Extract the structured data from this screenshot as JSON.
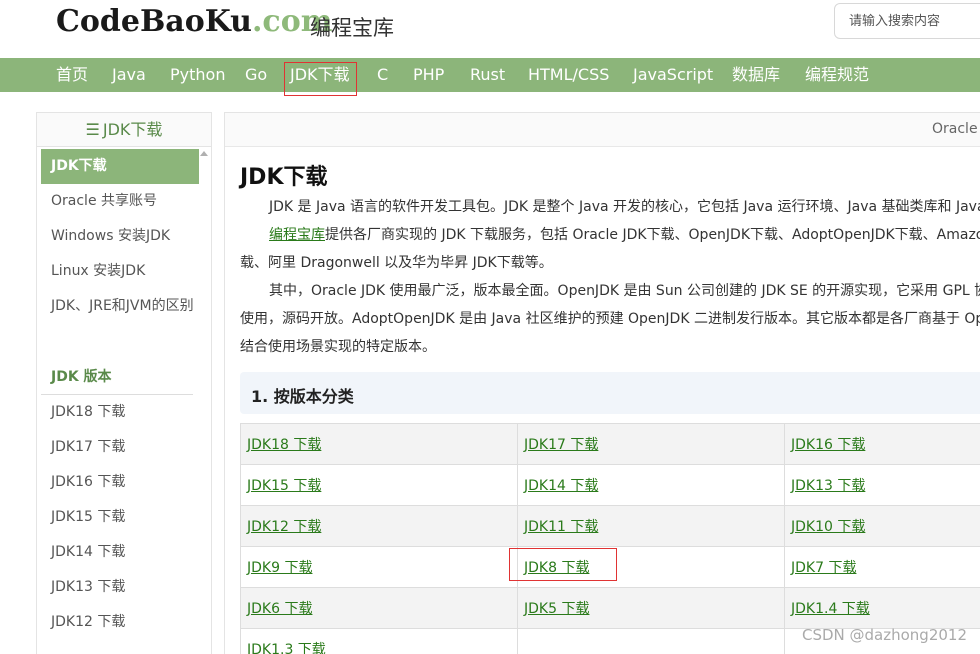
{
  "header": {
    "logo_text": "CodeBaoKu",
    "logo_dot": ".com",
    "logo_cn": "编程宝库",
    "search_placeholder": "请输入搜索内容"
  },
  "nav": {
    "items": [
      "首页",
      "Java",
      "Python",
      "Go",
      "JDK下载",
      "C",
      "PHP",
      "Rust",
      "HTML/CSS",
      "JavaScript",
      "数据库",
      "编程规范"
    ],
    "active_index": 4
  },
  "sidebar": {
    "title_icon": "menu-icon",
    "title": "JDK下载",
    "items": [
      {
        "label": "JDK下载",
        "active": true
      },
      {
        "label": "Oracle 共享账号"
      },
      {
        "label": "Windows 安装JDK"
      },
      {
        "label": "Linux 安装JDK"
      },
      {
        "label": "JDK、JRE和JVM的区别"
      }
    ],
    "section": "JDK 版本",
    "versions": [
      "JDK18 下载",
      "JDK17 下载",
      "JDK16 下载",
      "JDK15 下载",
      "JDK14 下载",
      "JDK13 下载",
      "JDK12 下载"
    ]
  },
  "main": {
    "breadcrumb": "Oracle",
    "title": "JDK下载",
    "p1": "JDK 是 Java 语言的软件开发工具包。JDK 是整个 Java 开发的核心，它包括 Java 运行环境、Java 基础类库和 Java",
    "p2_link": "编程宝库",
    "p2_rest": "提供各厂商实现的 JDK 下载服务，包括 Oracle JDK下载、OpenJDK下载、AdoptOpenJDK下载、Amazo",
    "p2_line2": "载、阿里 Dragonwell 以及华为毕昇 JDK下载等。",
    "p3_line1": "其中，Oracle JDK 使用最广泛，版本最全面。OpenJDK 是由 Sun 公司创建的 JDK SE 的开源实现，它采用 GPL 协",
    "p3_line2": "使用，源码开放。AdoptOpenJDK 是由 Java 社区维护的预建 OpenJDK 二进制发行版本。其它版本都是各厂商基于 Op",
    "p3_line3": "结合使用场景实现的特定版本。",
    "section_title": "1. 按版本分类",
    "downloads": [
      [
        "JDK18 下载",
        "JDK17 下载",
        "JDK16 下载"
      ],
      [
        "JDK15 下载",
        "JDK14 下载",
        "JDK13 下载"
      ],
      [
        "JDK12 下载",
        "JDK11 下载",
        "JDK10 下载"
      ],
      [
        "JDK9 下载",
        "JDK8 下载",
        "JDK7 下载"
      ],
      [
        "JDK6 下载",
        "JDK5 下载",
        "JDK1.4 下载"
      ],
      [
        "JDK1.3 下载",
        "",
        ""
      ]
    ]
  },
  "watermark": "CSDN @dazhong2012",
  "colors": {
    "brand_green": "#8cb57a",
    "link_green": "#2a7a1a",
    "highlight_red": "#e03333"
  }
}
